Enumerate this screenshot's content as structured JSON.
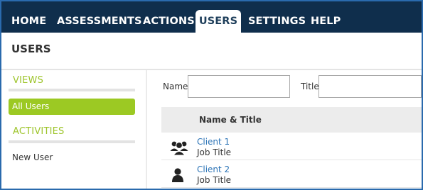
{
  "nav": {
    "home": "HOME",
    "assessments": "ASSESSMENTS",
    "actions": "ACTIONS",
    "users": "USERS",
    "settings": "SETTINGS",
    "help": "HELP"
  },
  "page": {
    "title": "USERS"
  },
  "sidebar": {
    "views_heading": "VIEWS",
    "all_users": "All Users",
    "activities_heading": "ACTIVITIES",
    "new_user": "New User"
  },
  "filters": {
    "name_label": "Name",
    "name_value": "",
    "title_label": "Title",
    "title_value": ""
  },
  "grid": {
    "header": "Name & Title",
    "rows": [
      {
        "name": "Client 1",
        "title": "Job Title",
        "icon": "users-group-icon"
      },
      {
        "name": "Client 2",
        "title": "Job Title",
        "icon": "user-icon"
      }
    ]
  },
  "colors": {
    "nav_bg": "#0f2e4c",
    "accent_green": "#9cc923",
    "link_blue": "#2b73b6",
    "frame_border": "#2a6aad"
  }
}
